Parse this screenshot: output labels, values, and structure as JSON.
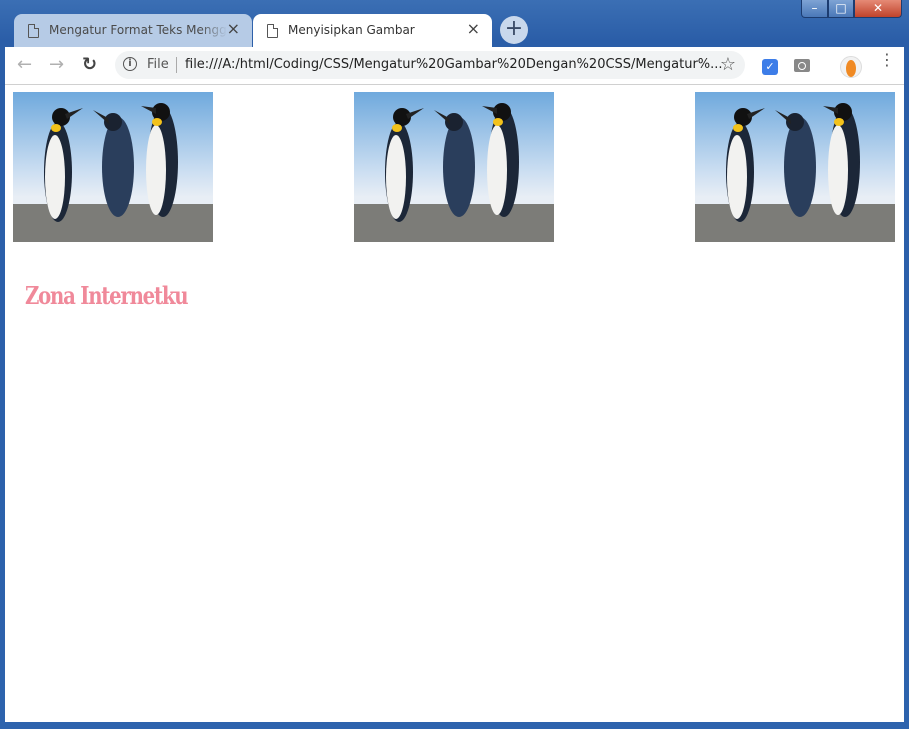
{
  "browser": {
    "tabs": [
      {
        "title": "Mengatur Format Teks Menggun",
        "close": "×",
        "active": false
      },
      {
        "title": "Menyisipkan Gambar",
        "close": "×",
        "active": true
      }
    ],
    "new_tab": "+",
    "window_controls": {
      "minimize": "–",
      "maximize": "□",
      "close": "✕"
    },
    "nav": {
      "back": "←",
      "forward": "→",
      "reload": "↻"
    },
    "address": {
      "scheme_label": "File",
      "url": "file:///A:/html/Coding/CSS/Mengatur%20Gambar%20Dengan%20CSS/Mengatur%..."
    },
    "star": "☆",
    "menu": "⋮"
  },
  "page": {
    "images": [
      {
        "subject": "penguins"
      },
      {
        "subject": "penguins"
      },
      {
        "subject": "penguins"
      }
    ],
    "heading": "Zona Internetku"
  },
  "colors": {
    "heading": "#f0899a",
    "tab_active": "#ffffff",
    "tab_inactive": "#b6cbe6",
    "frame": "#2b5ea8"
  }
}
